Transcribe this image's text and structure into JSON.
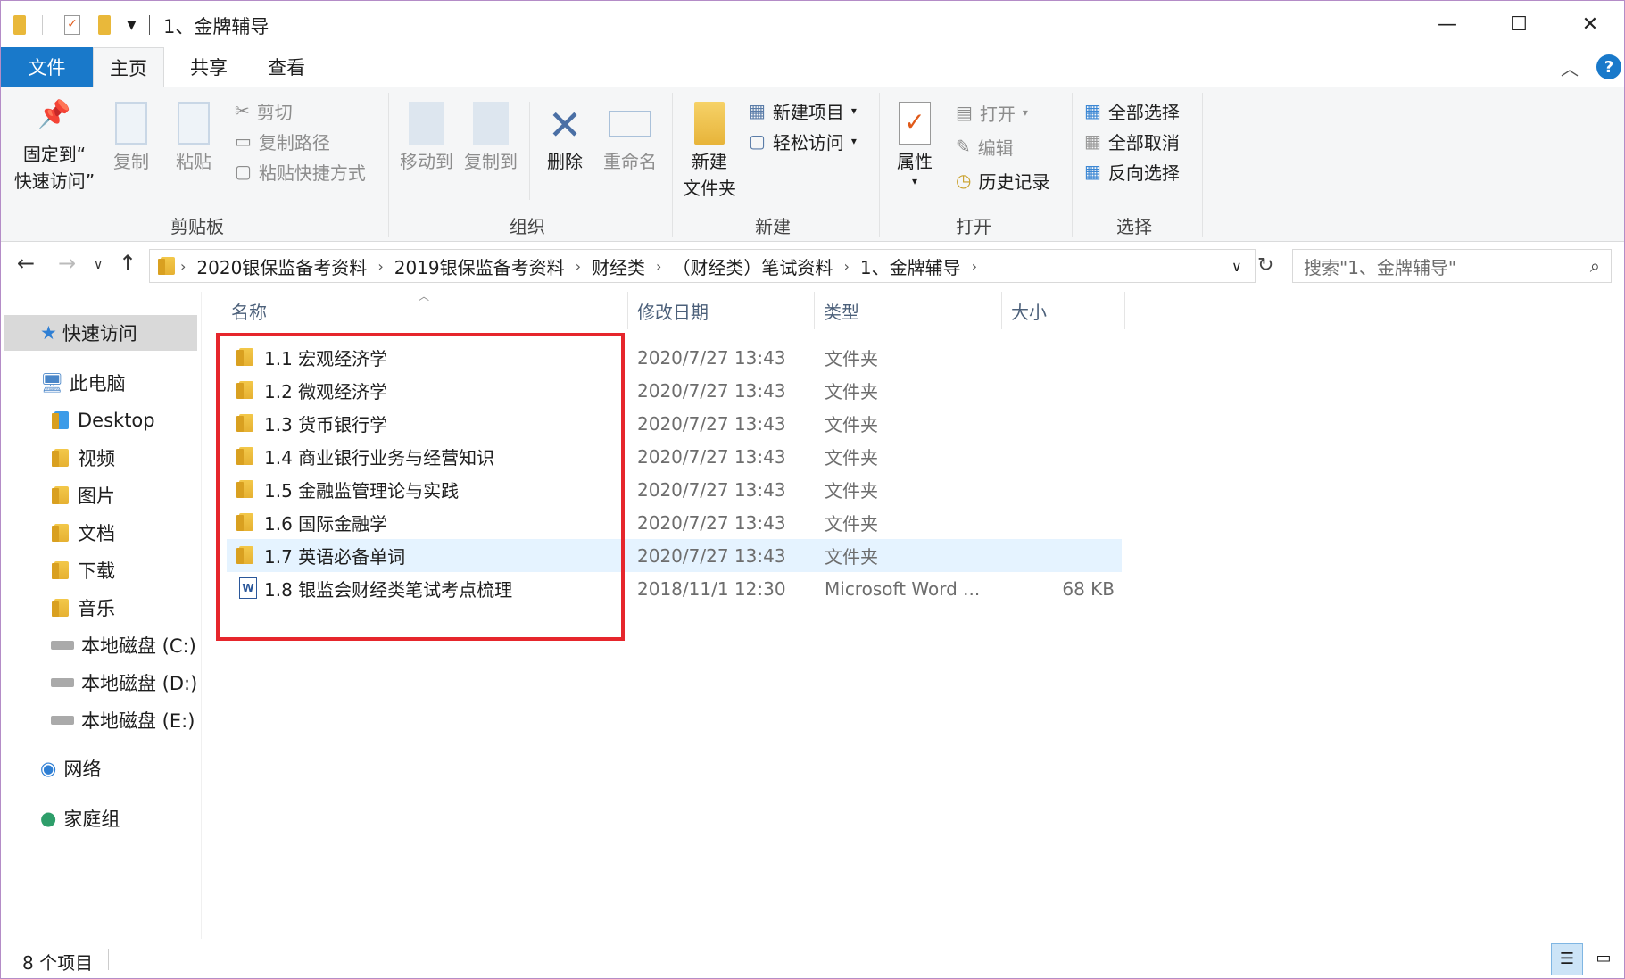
{
  "window": {
    "title": "1、金牌辅导",
    "controls": {
      "minimize": "—",
      "maximize": "☐",
      "close": "✕"
    }
  },
  "ribbon_tabs": [
    "文件",
    "主页",
    "共享",
    "查看"
  ],
  "help_label": "?",
  "ribbon": {
    "clipboard": {
      "pin_line1": "固定到“",
      "pin_line2": "快速访问”",
      "copy": "复制",
      "paste": "粘贴",
      "cut": "剪切",
      "copy_path": "复制路径",
      "paste_shortcut": "粘贴快捷方式",
      "label": "剪贴板"
    },
    "organize": {
      "move_to": "移动到",
      "copy_to": "复制到",
      "delete": "删除",
      "rename": "重命名",
      "label": "组织"
    },
    "new": {
      "new_folder_line1": "新建",
      "new_folder_line2": "文件夹",
      "new_item": "新建项目",
      "easy_access": "轻松访问",
      "label": "新建"
    },
    "open": {
      "properties": "属性",
      "open": "打开",
      "edit": "编辑",
      "history": "历史记录",
      "label": "打开"
    },
    "select": {
      "select_all": "全部选择",
      "select_none": "全部取消",
      "invert": "反向选择",
      "label": "选择"
    }
  },
  "address": {
    "breadcrumbs": [
      "2020银保监备考资料",
      "2019银保监备考资料",
      "财经类",
      "（财经类）笔试资料",
      "1、金牌辅导"
    ],
    "search_placeholder": "搜索\"1、金牌辅导\""
  },
  "nav_pane": {
    "quick_access": "快速访问",
    "this_pc": "此电脑",
    "items": [
      "Desktop",
      "视频",
      "图片",
      "文档",
      "下载",
      "音乐",
      "本地磁盘 (C:)",
      "本地磁盘 (D:)",
      "本地磁盘 (E:)"
    ],
    "network": "网络",
    "homegroup": "家庭组"
  },
  "columns": [
    "名称",
    "修改日期",
    "类型",
    "大小"
  ],
  "files": [
    {
      "name": "1.1 宏观经济学",
      "date": "2020/7/27 13:43",
      "type": "文件夹",
      "size": "",
      "icon": "folder-icon"
    },
    {
      "name": "1.2 微观经济学",
      "date": "2020/7/27 13:43",
      "type": "文件夹",
      "size": "",
      "icon": "folder-icon"
    },
    {
      "name": "1.3 货币银行学",
      "date": "2020/7/27 13:43",
      "type": "文件夹",
      "size": "",
      "icon": "folder-icon"
    },
    {
      "name": "1.4 商业银行业务与经营知识",
      "date": "2020/7/27 13:43",
      "type": "文件夹",
      "size": "",
      "icon": "folder-icon"
    },
    {
      "name": "1.5 金融监管理论与实践",
      "date": "2020/7/27 13:43",
      "type": "文件夹",
      "size": "",
      "icon": "folder-icon"
    },
    {
      "name": "1.6 国际金融学",
      "date": "2020/7/27 13:43",
      "type": "文件夹",
      "size": "",
      "icon": "folder-icon"
    },
    {
      "name": "1.7 英语必备单词",
      "date": "2020/7/27 13:43",
      "type": "文件夹",
      "size": "",
      "icon": "folder-icon"
    },
    {
      "name": "1.8 银监会财经类笔试考点梳理",
      "date": "2018/11/1 12:30",
      "type": "Microsoft Word ...",
      "size": "68 KB",
      "icon": "word-doc-icon"
    }
  ],
  "status": {
    "item_count": "8 个项目"
  },
  "colors": {
    "accent": "#1979ca",
    "highlight_box": "#e6262c",
    "selected_row": "#e5f3ff"
  }
}
